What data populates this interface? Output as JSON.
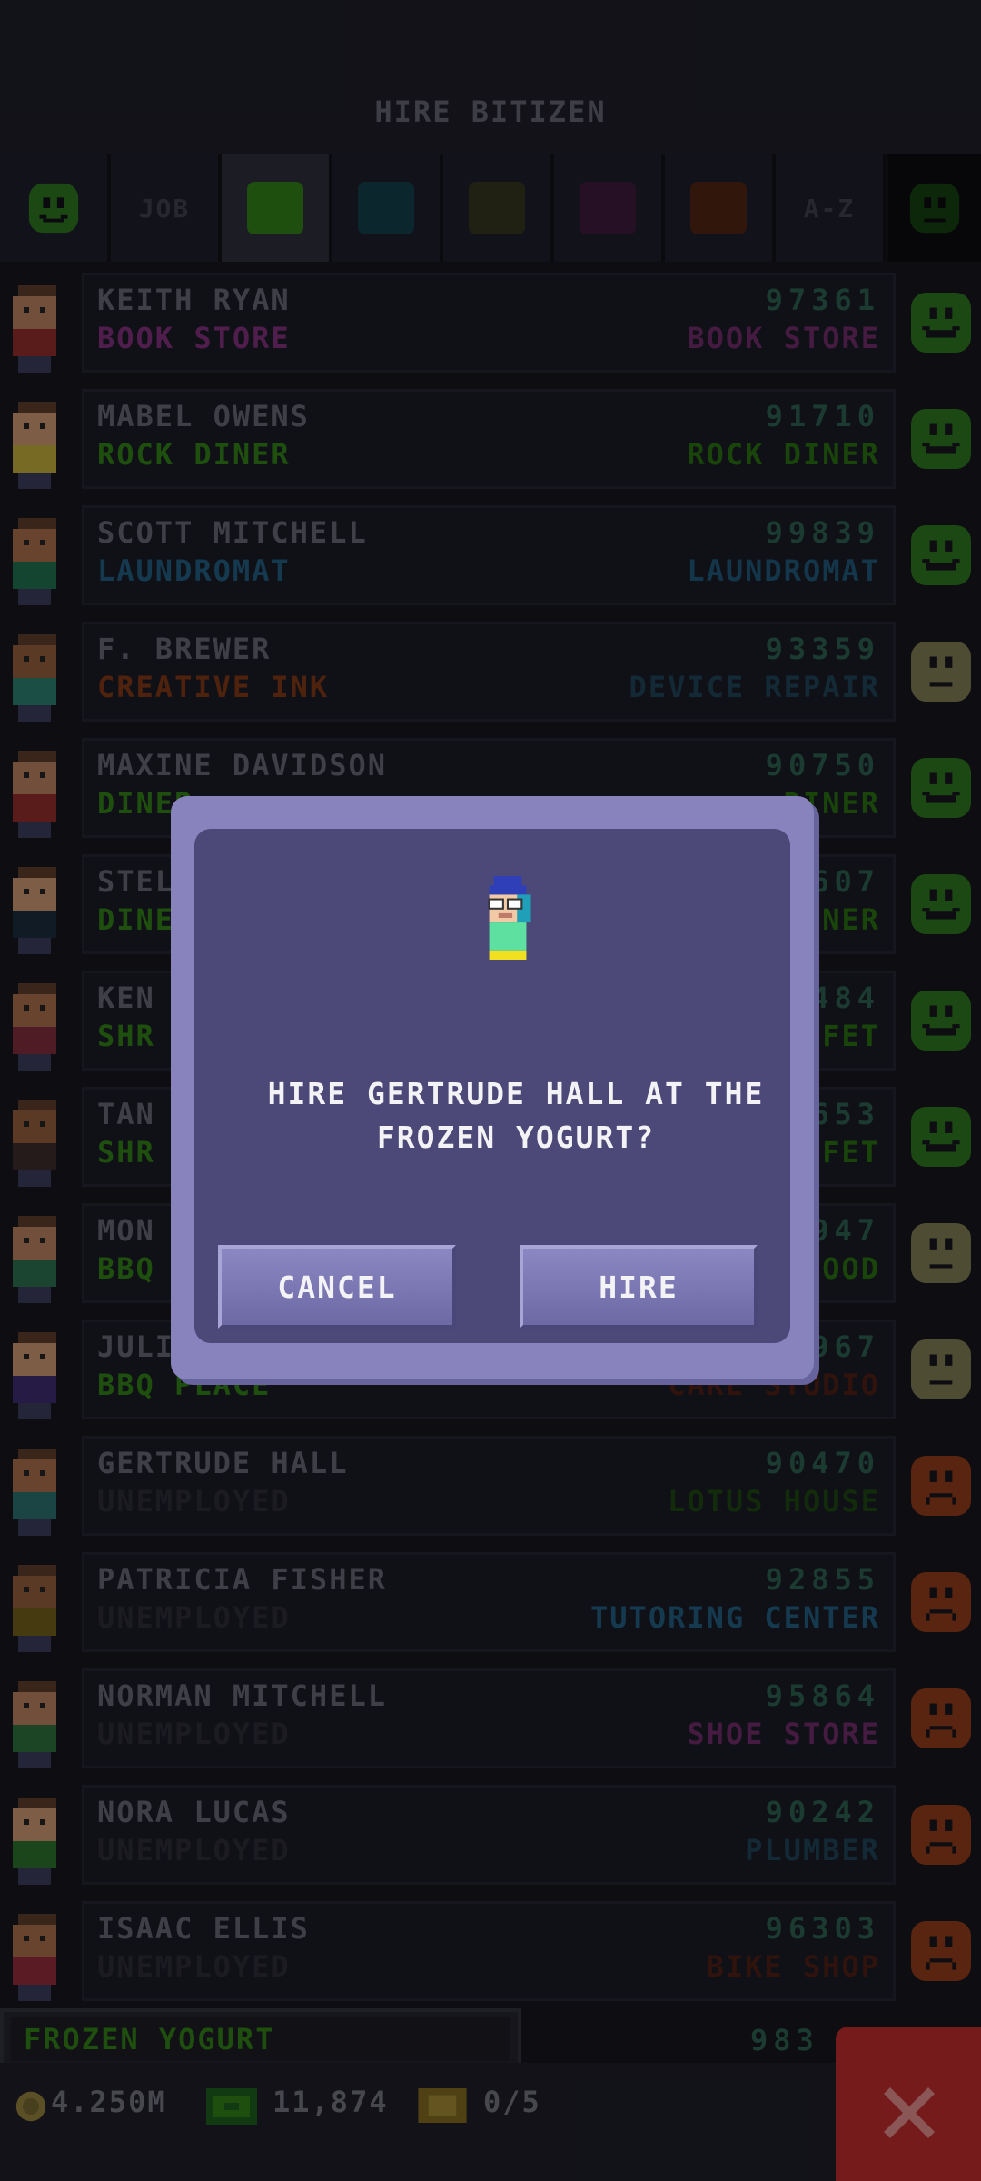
{
  "header": {
    "title": "HIRE BITIZEN"
  },
  "tabs": {
    "job_label": "JOB",
    "az_label": "A-Z"
  },
  "bitizens": [
    {
      "name": "KEITH RYAN",
      "job": "BOOK STORE",
      "job_color": "#7b2f76",
      "score": "97361",
      "dream_job": "BOOK STORE",
      "dream_color": "#6a2a66",
      "mood": "happy"
    },
    {
      "name": "MABEL OWENS",
      "job": "ROCK DINER",
      "job_color": "#2f7a16",
      "score": "91710",
      "dream_job": "ROCK DINER",
      "dream_color": "#276a12",
      "mood": "happy"
    },
    {
      "name": "SCOTT MITCHELL",
      "job": "LAUNDROMAT",
      "job_color": "#215a7b",
      "score": "99839",
      "dream_job": "LAUNDROMAT",
      "dream_color": "#1f5474",
      "mood": "happy"
    },
    {
      "name": "F. BREWER",
      "job": "CREATIVE INK",
      "job_color": "#7a3514",
      "score": "93359",
      "dream_job": "DEVICE REPAIR",
      "dream_color": "#1e3f52",
      "mood": "neutral"
    },
    {
      "name": "MAXINE DAVIDSON",
      "job": "DINER",
      "job_color": "#2f7a16",
      "score": "90750",
      "dream_job": "DINER",
      "dream_color": "#276a12",
      "mood": "happy"
    },
    {
      "name": "STEL",
      "job": "DINE",
      "job_color": "#2f7a16",
      "score": "607",
      "dream_job": "NER",
      "dream_color": "#276a12",
      "mood": "happy"
    },
    {
      "name": "KEN",
      "job": "SHR",
      "job_color": "#2f7a16",
      "score": "484",
      "dream_job": "FFET",
      "dream_color": "#276a12",
      "mood": "happy"
    },
    {
      "name": "TAN",
      "job": "SHR",
      "job_color": "#2f7a16",
      "score": "653",
      "dream_job": "FFET",
      "dream_color": "#276a12",
      "mood": "happy"
    },
    {
      "name": "MON",
      "job": "BBQ",
      "job_color": "#2f7a16",
      "score": "947",
      "dream_job": "OOD",
      "dream_color": "#276a12",
      "mood": "neutral"
    },
    {
      "name": "JULI",
      "job": "BBQ PLACE",
      "job_color": "#2f7a16",
      "score": "967",
      "dream_job": "CAKE STUDIO",
      "dream_color": "#4a1e14",
      "mood": "neutral"
    },
    {
      "name": "GERTRUDE HALL",
      "job": "UNEMPLOYED",
      "job_color": "#2a2a34",
      "score": "90470",
      "dream_job": "LOTUS HOUSE",
      "dream_color": "#1c4212",
      "mood": "sad"
    },
    {
      "name": "PATRICIA FISHER",
      "job": "UNEMPLOYED",
      "job_color": "#2a2a34",
      "score": "92855",
      "dream_job": "TUTORING CENTER",
      "dream_color": "#215a7b",
      "mood": "sad"
    },
    {
      "name": "NORMAN MITCHELL",
      "job": "UNEMPLOYED",
      "job_color": "#2a2a34",
      "score": "95864",
      "dream_job": "SHOE STORE",
      "dream_color": "#6a2a66",
      "mood": "sad"
    },
    {
      "name": "NORA LUCAS",
      "job": "UNEMPLOYED",
      "job_color": "#2a2a34",
      "score": "90242",
      "dream_job": "PLUMBER",
      "dream_color": "#1e3f52",
      "mood": "sad"
    },
    {
      "name": "ISAAC ELLIS",
      "job": "UNEMPLOYED",
      "job_color": "#2a2a34",
      "score": "96303",
      "dream_job": "BIKE SHOP",
      "dream_color": "#4a1e14",
      "mood": "sad"
    }
  ],
  "partial_score": "983",
  "dialog": {
    "message": "HIRE GERTRUDE HALL AT THE FROZEN YOGURT?",
    "cancel_label": "CANCEL",
    "hire_label": "HIRE"
  },
  "footer": {
    "shop_name": "FROZEN YOGURT",
    "coins": "4.250M",
    "bux": "11,874",
    "tickets": "0/5"
  }
}
